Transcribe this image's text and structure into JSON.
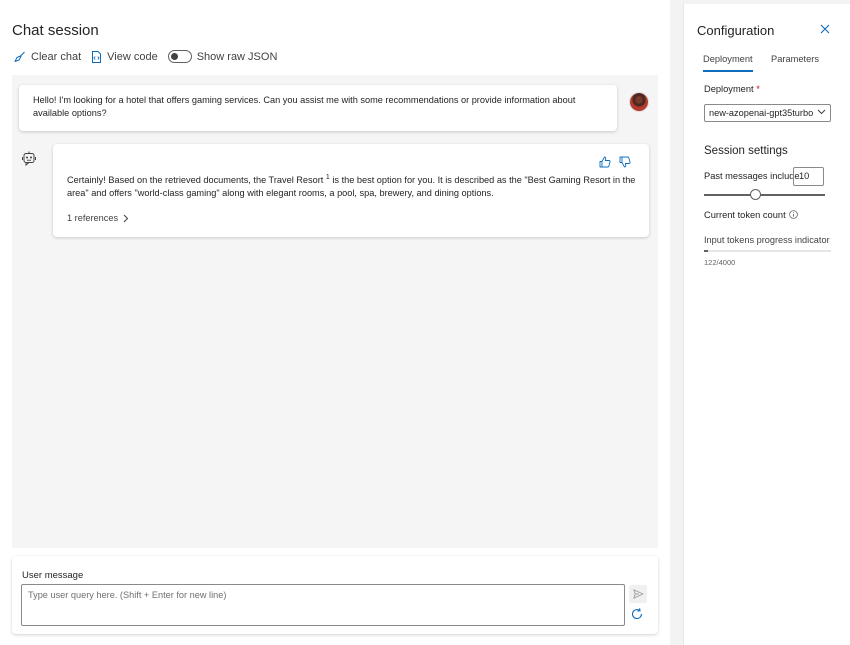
{
  "chat": {
    "title": "Chat session",
    "toolbar": {
      "clear_label": "Clear chat",
      "view_code_label": "View code",
      "raw_json_label": "Show raw JSON"
    },
    "messages": [
      {
        "role": "user",
        "text": "Hello! I'm looking for a hotel that offers gaming services. Can you assist me with some recommendations or provide information about available options?"
      },
      {
        "role": "assistant",
        "text_before": "Certainly! Based on the retrieved documents, the Travel Resort ",
        "citation": "1",
        "text_after": " is the best option for you. It is described as the \"Best Gaming Resort in the area\" and offers \"world-class gaming\" along with elegant rooms, a pool, spa, brewery, and dining options.",
        "references_label": "1 references"
      }
    ],
    "input": {
      "label": "User message",
      "placeholder": "Type user query here. (Shift + Enter for new line)"
    }
  },
  "config": {
    "title": "Configuration",
    "tabs": [
      "Deployment",
      "Parameters"
    ],
    "active_tab": "Deployment",
    "deployment_label": "Deployment",
    "required_mark": "*",
    "deployment_value": "new-azopenai-gpt35turbo",
    "session_settings_title": "Session settings",
    "past_messages_label": "Past messages include",
    "past_messages_value": "10",
    "past_messages_slider_fraction": 0.42,
    "token_count_label": "Current token count",
    "progress_label": "Input tokens progress indicator",
    "token_count_value": "122/4000",
    "token_fraction": 0.0305
  },
  "colors": {
    "accent": "#0f6cbd",
    "required": "#c50f1f"
  }
}
